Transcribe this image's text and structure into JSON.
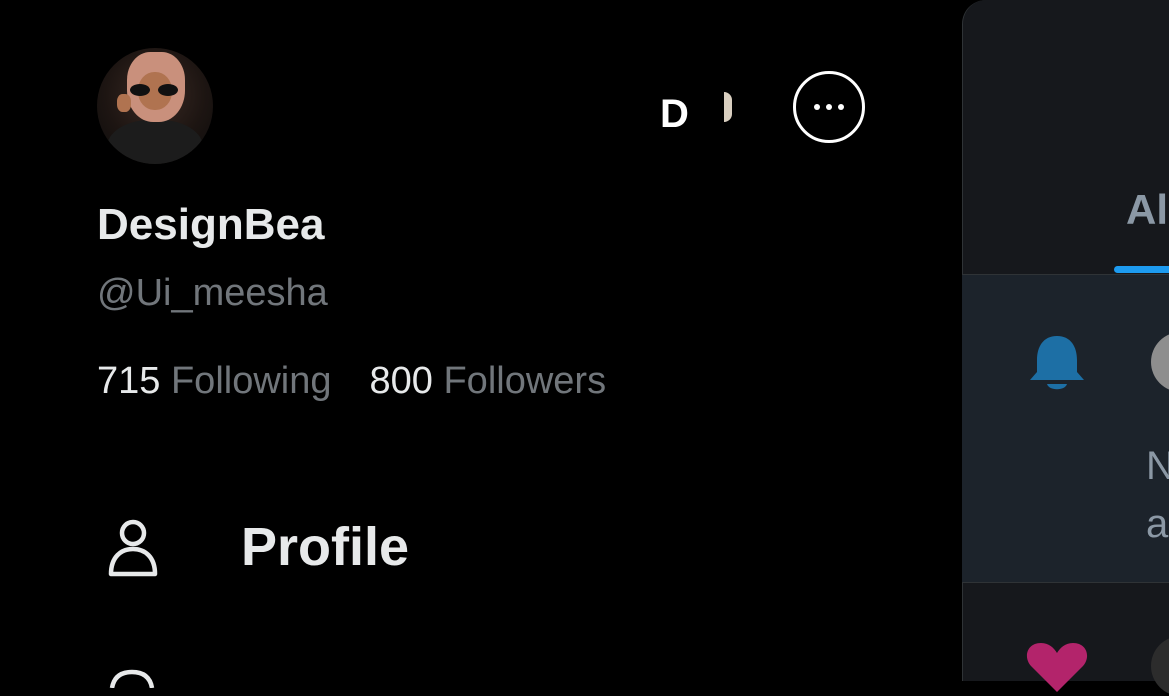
{
  "account": {
    "display_name": "DesignBea",
    "handle": "@Ui_meesha",
    "following_count": "715",
    "following_label": "Following",
    "followers_count": "800",
    "followers_label": "Followers",
    "switch_account_initial": "D"
  },
  "nav": {
    "items": [
      {
        "label": "Profile",
        "icon": "person-icon"
      }
    ]
  },
  "notifications_panel": {
    "tab_label_partial": "Al",
    "row_text_partial_1": "N",
    "row_text_partial_2": "a",
    "colors": {
      "bell": "#1d6fa5",
      "heart": "#b3246b",
      "tab_underline": "#1d9bf0"
    }
  }
}
